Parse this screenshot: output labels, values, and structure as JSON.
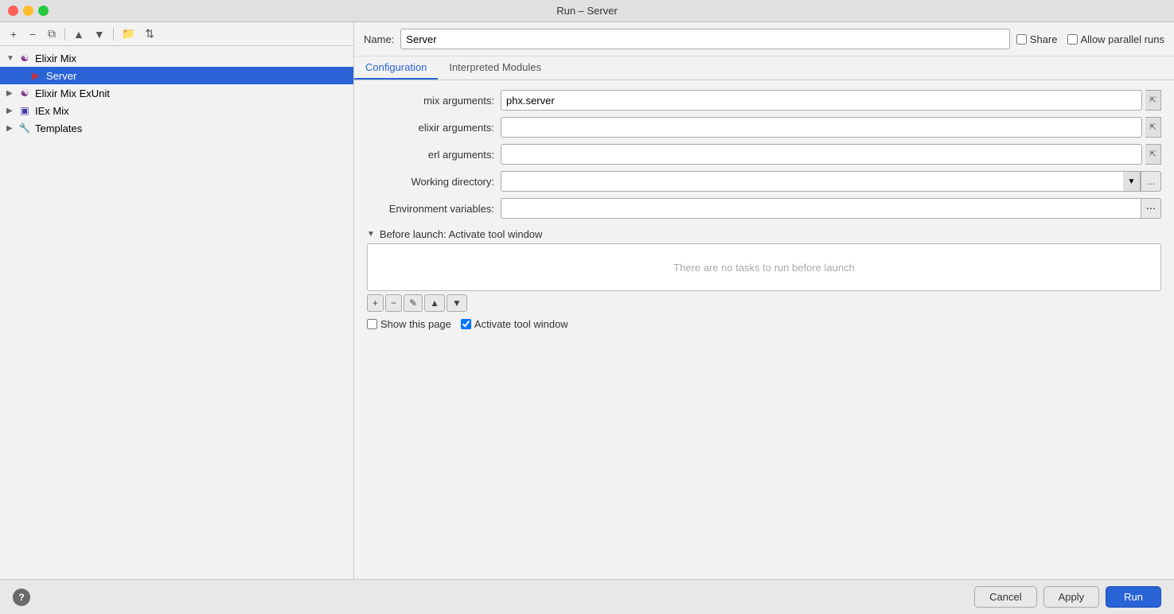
{
  "window": {
    "title": "Run – Server"
  },
  "toolbar": {
    "add_label": "+",
    "remove_label": "−",
    "copy_label": "⧉",
    "sort_up_label": "▲",
    "sort_down_label": "▼",
    "folder_label": "📁",
    "sort_label": "⇅"
  },
  "left_panel": {
    "tree": [
      {
        "id": "elixir-mix",
        "label": "Elixir Mix",
        "level": 0,
        "expanded": true,
        "has_arrow": true,
        "icon": "elixir",
        "selected": false
      },
      {
        "id": "server",
        "label": "Server",
        "level": 1,
        "has_arrow": false,
        "icon": "server",
        "selected": true
      },
      {
        "id": "elixir-mix-exunit",
        "label": "Elixir Mix ExUnit",
        "level": 0,
        "has_arrow": true,
        "expanded": false,
        "icon": "elixir",
        "selected": false
      },
      {
        "id": "iex-mix",
        "label": "IEx Mix",
        "level": 0,
        "has_arrow": true,
        "expanded": false,
        "icon": "iex",
        "selected": false
      },
      {
        "id": "templates",
        "label": "Templates",
        "level": 0,
        "has_arrow": true,
        "expanded": false,
        "icon": "wrench",
        "selected": false
      }
    ]
  },
  "name_bar": {
    "label": "Name:",
    "value": "Server",
    "share_label": "Share",
    "allow_parallel_label": "Allow parallel runs",
    "share_checked": false,
    "allow_parallel_checked": false
  },
  "tabs": [
    {
      "id": "configuration",
      "label": "Configuration",
      "active": true
    },
    {
      "id": "interpreted-modules",
      "label": "Interpreted Modules",
      "active": false
    }
  ],
  "config": {
    "fields": [
      {
        "id": "mix-arguments",
        "label": "mix arguments:",
        "value": "phx.server",
        "expandable": true
      },
      {
        "id": "elixir-arguments",
        "label": "elixir arguments:",
        "value": "",
        "expandable": true
      },
      {
        "id": "erl-arguments",
        "label": "erl arguments:",
        "value": "",
        "expandable": true
      }
    ],
    "working_directory": {
      "label": "Working directory:",
      "value": ""
    },
    "environment_variables": {
      "label": "Environment variables:",
      "value": ""
    }
  },
  "before_launch": {
    "section_label": "Before launch: Activate tool window",
    "empty_text": "There are no tasks to run before launch",
    "toolbar": {
      "add": "+",
      "remove": "−",
      "edit": "✎",
      "move_up": "▲",
      "move_down": "▼"
    },
    "show_page_label": "Show this page",
    "show_page_checked": false,
    "activate_tool_label": "Activate tool window",
    "activate_tool_checked": true
  },
  "bottom": {
    "help_label": "?",
    "cancel_label": "Cancel",
    "apply_label": "Apply",
    "run_label": "Run"
  }
}
